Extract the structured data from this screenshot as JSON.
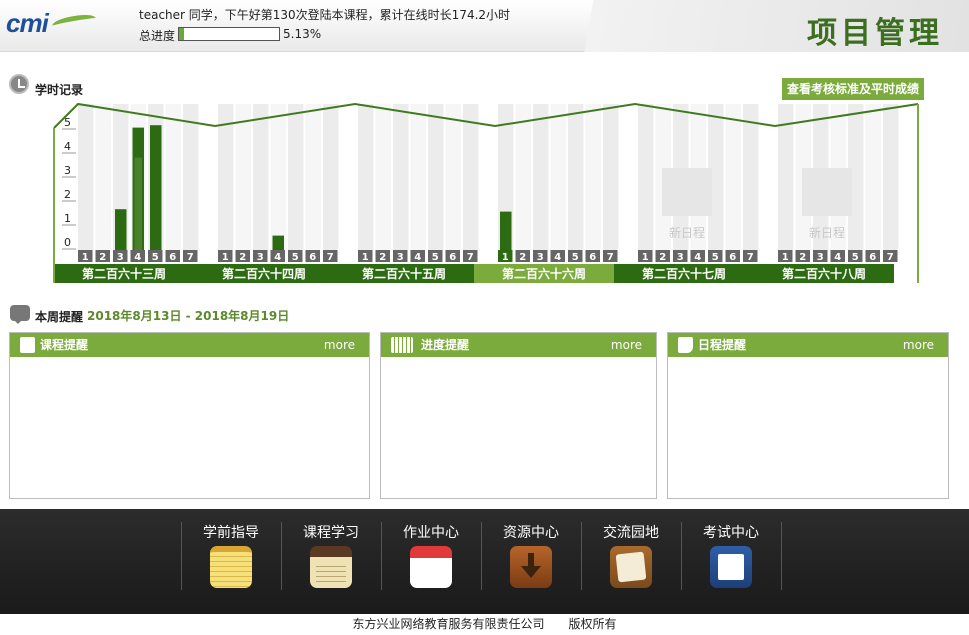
{
  "header": {
    "logo_text": "cmi",
    "greeting": "teacher 同学，下午好第130次登陆本课程，累计在线时长174.2小时",
    "progress_label": "总进度",
    "progress_value": 0.0513,
    "progress_text": "5.13%",
    "page_title": "项目管理"
  },
  "study_record": {
    "title": "学时记录",
    "check_button": "查看考核标准及平时成绩",
    "new_schedule_label": "新日程",
    "y_ticks": [
      "5",
      "4",
      "3",
      "2",
      "1",
      "0"
    ],
    "day_labels": [
      "1",
      "2",
      "3",
      "4",
      "5",
      "6",
      "7"
    ],
    "weeks": [
      {
        "label": "第二百六十三周",
        "values": [
          0,
          0,
          1.7,
          5.1,
          5.2,
          0,
          0
        ],
        "current": false,
        "new_schedule": false
      },
      {
        "label": "第二百六十四周",
        "values": [
          0,
          0,
          0,
          0.6,
          0,
          0,
          0
        ],
        "current": false,
        "new_schedule": false
      },
      {
        "label": "第二百六十五周",
        "values": [
          0,
          0,
          0,
          0,
          0,
          0,
          0
        ],
        "current": false,
        "new_schedule": false
      },
      {
        "label": "第二百六十六周",
        "values": [
          1.6,
          0,
          0,
          0,
          0,
          0,
          0
        ],
        "current": true,
        "new_schedule": false
      },
      {
        "label": "第二百六十七周",
        "values": [
          0,
          0,
          0,
          0,
          0,
          0,
          0
        ],
        "current": false,
        "new_schedule": true
      },
      {
        "label": "第二百六十八周",
        "values": [
          0,
          0,
          0,
          0,
          0,
          0,
          0
        ],
        "current": false,
        "new_schedule": true
      }
    ]
  },
  "weekly": {
    "title": "本周提醒",
    "range": "2018年8月13日 - 2018年8月19日",
    "panels": [
      {
        "title": "课程提醒",
        "more": "more",
        "icon": "document-icon"
      },
      {
        "title": "进度提醒",
        "more": "more",
        "icon": "calendar-icon"
      },
      {
        "title": "日程提醒",
        "more": "more",
        "icon": "note-icon"
      }
    ]
  },
  "footer_nav": [
    {
      "label": "学前指导",
      "icon": "notepad-icon"
    },
    {
      "label": "课程学习",
      "icon": "notebook-icon"
    },
    {
      "label": "作业中心",
      "icon": "calendar-page-icon"
    },
    {
      "label": "资源中心",
      "icon": "download-icon"
    },
    {
      "label": "交流园地",
      "icon": "chat-board-icon"
    },
    {
      "label": "考试中心",
      "icon": "book-icon"
    }
  ],
  "copyright": "东方兴业网络教育服务有限责任公司　　版权所有",
  "colors": {
    "accent": "#7bab3c",
    "dark_green": "#2d6b12",
    "title_green": "#3c6e1f"
  }
}
